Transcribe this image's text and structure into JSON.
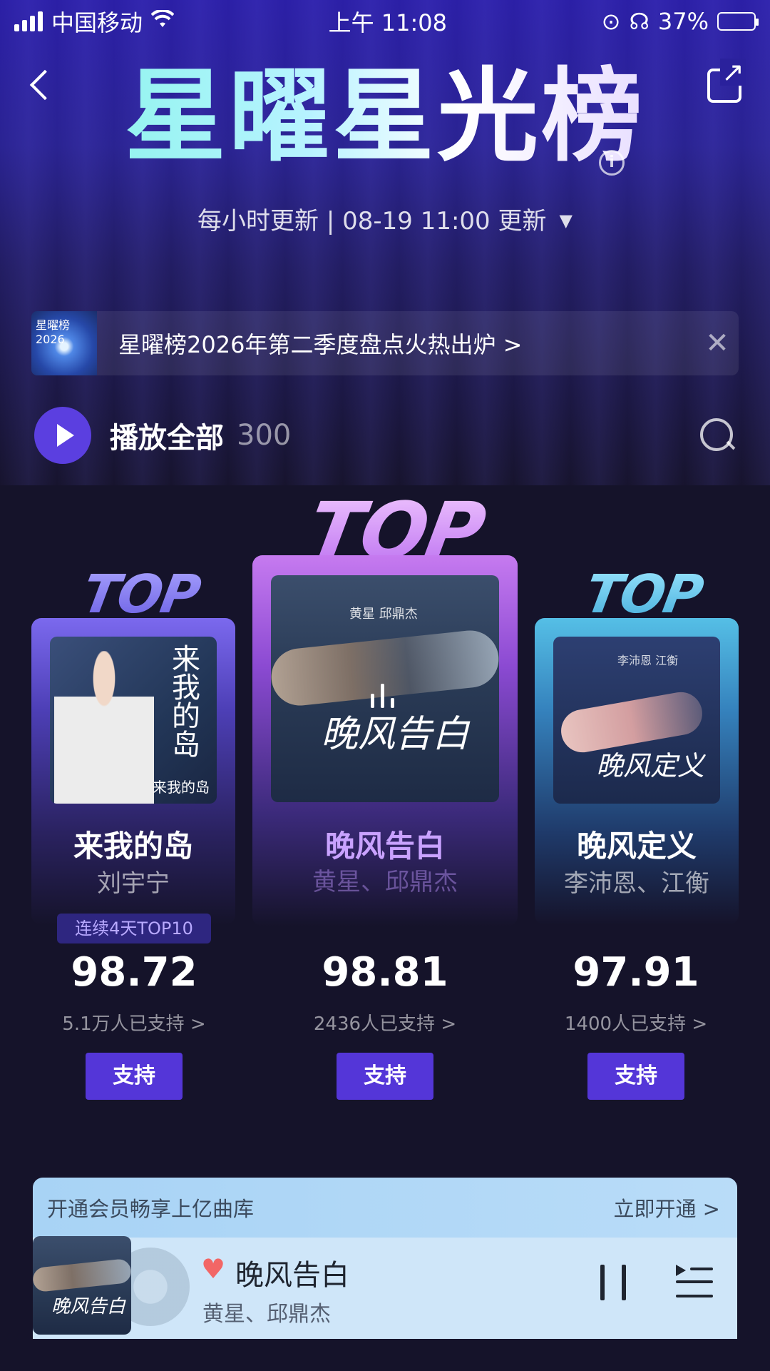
{
  "status": {
    "carrier": "中国移动",
    "time": "上午 11:08",
    "battery": "37%",
    "battery_level": 0.37
  },
  "header": {
    "title": "星曜星光榜",
    "update_info": "每小时更新 | 08-19 11:00 更新",
    "info_glyph": "i"
  },
  "banner": {
    "thumb_text": "星曜榜 2026",
    "text": "星曜榜2026年第二季度盘点火热出炉 >",
    "close_glyph": "✕"
  },
  "play_all": {
    "label": "播放全部",
    "count": "300"
  },
  "ranking": [
    {
      "rank_label": "TOP 1",
      "song": "晚风告白",
      "artist": "黄星、邱鼎杰",
      "score": "98.81",
      "supporters": "2436人已支持 >",
      "support_label": "支持",
      "cover_title": "晚风告白",
      "cover_signature": "黄星 邱鼎杰"
    },
    {
      "rank_label": "TOP 2",
      "song": "来我的岛",
      "artist": "刘宇宁",
      "streak": "连续4天TOP10",
      "score": "98.72",
      "supporters": "5.1万人已支持 >",
      "support_label": "支持",
      "cover_title": "来我的岛",
      "cover_signature": "来我的岛"
    },
    {
      "rank_label": "TOP 3",
      "song": "晚风定义",
      "artist": "李沛恩、江衡",
      "score": "97.91",
      "supporters": "1400人已支持 >",
      "support_label": "支持",
      "cover_title": "晚风定义",
      "cover_signature": "李沛恩 江衡"
    }
  ],
  "vip": {
    "text": "开通会员畅享上亿曲库",
    "action": "立即开通 >"
  },
  "player": {
    "title": "晚风告白",
    "artist": "黄星、邱鼎杰",
    "heart_glyph": "♥",
    "cover_title": "晚风告白"
  },
  "colors": {
    "accent": "#5436d8",
    "heart": "#f26666"
  }
}
